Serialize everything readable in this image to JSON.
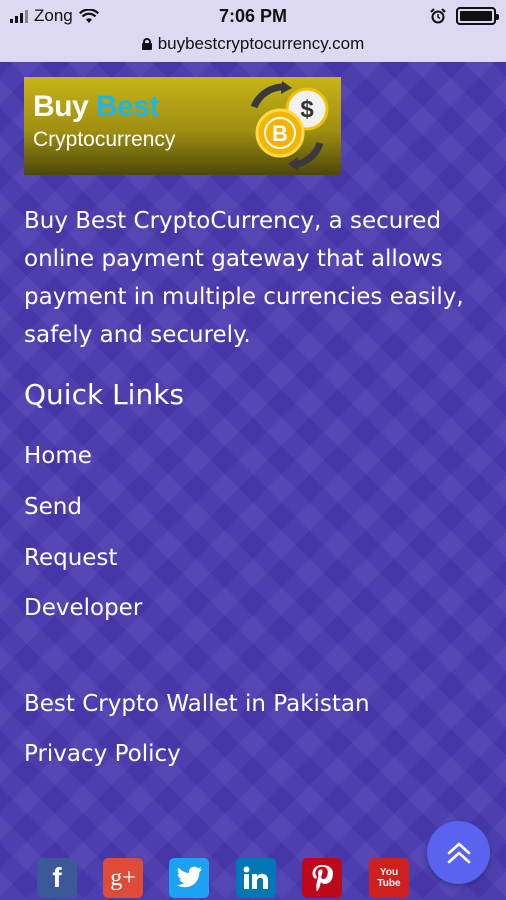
{
  "status_bar": {
    "carrier": "Zong",
    "time": "7:06 PM"
  },
  "url_bar": {
    "url": "buybestcryptocurrency.com"
  },
  "logo": {
    "line1_part1": "Buy ",
    "line1_part2": "Best",
    "line2": "Cryptocurrency",
    "coin_symbols": [
      "$",
      "B"
    ]
  },
  "intro_text": "Buy Best CryptoCurrency, a secured online payment gateway that allows payment in multiple currencies easily, safely and securely.",
  "quick_links": {
    "title": "Quick Links",
    "items": [
      "Home",
      "Send",
      "Request",
      "Developer"
    ]
  },
  "extra_links": [
    "Best Crypto Wallet in Pakistan",
    "Privacy Policy"
  ],
  "social": [
    {
      "name": "facebook-icon",
      "color": "#3b5998"
    },
    {
      "name": "google-plus-icon",
      "color": "#dd4b39"
    },
    {
      "name": "twitter-icon",
      "color": "#1da1f2"
    },
    {
      "name": "linkedin-icon",
      "color": "#0077b5"
    },
    {
      "name": "pinterest-icon",
      "color": "#bd081c"
    },
    {
      "name": "youtube-icon",
      "color": "#cd201f"
    }
  ],
  "social_labels": {
    "facebook": "f",
    "google_plus": "g+",
    "youtube": "You Tube"
  },
  "colors": {
    "background": "#4839ae",
    "fab": "#5a63ee",
    "browser_chrome": "#ddd9f2"
  }
}
